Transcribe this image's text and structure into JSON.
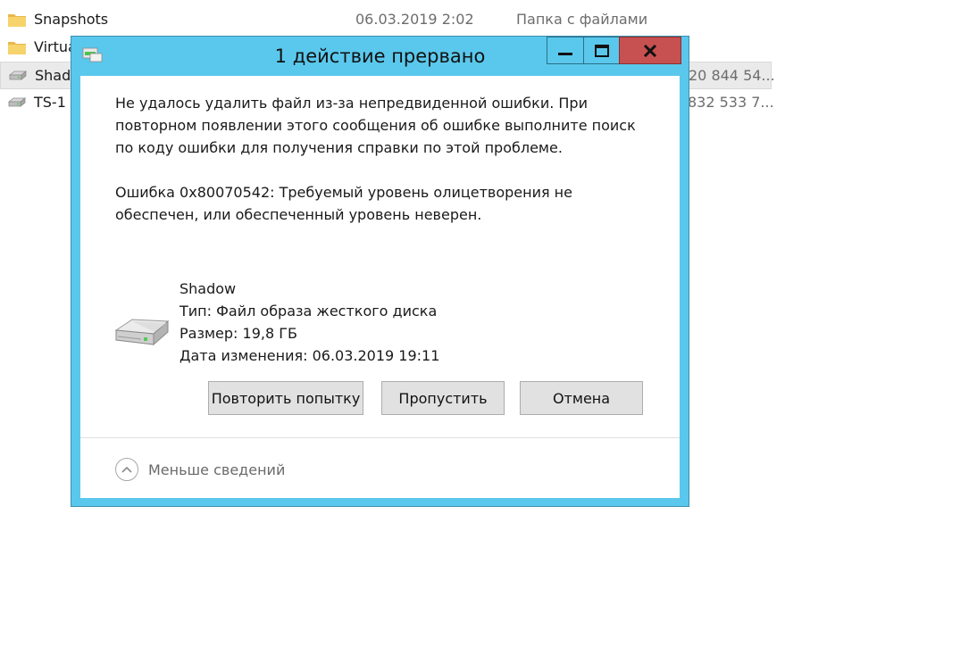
{
  "explorer": {
    "rows": [
      {
        "name": "Snapshots",
        "date": "06.03.2019 2:02",
        "type": "Папка с файлами",
        "size": ""
      },
      {
        "name": "Virtua",
        "date": "",
        "type": "",
        "size": ""
      },
      {
        "name": "Shad",
        "date": "",
        "type": "",
        "size": "20 844 54..."
      },
      {
        "name": "TS-1",
        "date": "",
        "type": "",
        "size": "832 533 7..."
      }
    ]
  },
  "dialog": {
    "title": "1 действие прервано",
    "message": "Не удалось удалить файл из-за непредвиденной ошибки. При\nповторном появлении этого сообщения об ошибке выполните поиск\nпо коду ошибки для получения справки по этой проблеме.",
    "error": "Ошибка 0x80070542: Требуемый уровень олицетворения не\nобеспечен, или обеспеченный уровень неверен.",
    "file": {
      "name": "Shadow",
      "type": "Тип: Файл образа жесткого диска",
      "size": "Размер: 19,8 ГБ",
      "modified": "Дата изменения: 06.03.2019 19:11"
    },
    "buttons": {
      "retry": "Повторить попытку",
      "skip": "Пропустить",
      "cancel": "Отмена"
    },
    "less_details": "Меньше сведений"
  }
}
